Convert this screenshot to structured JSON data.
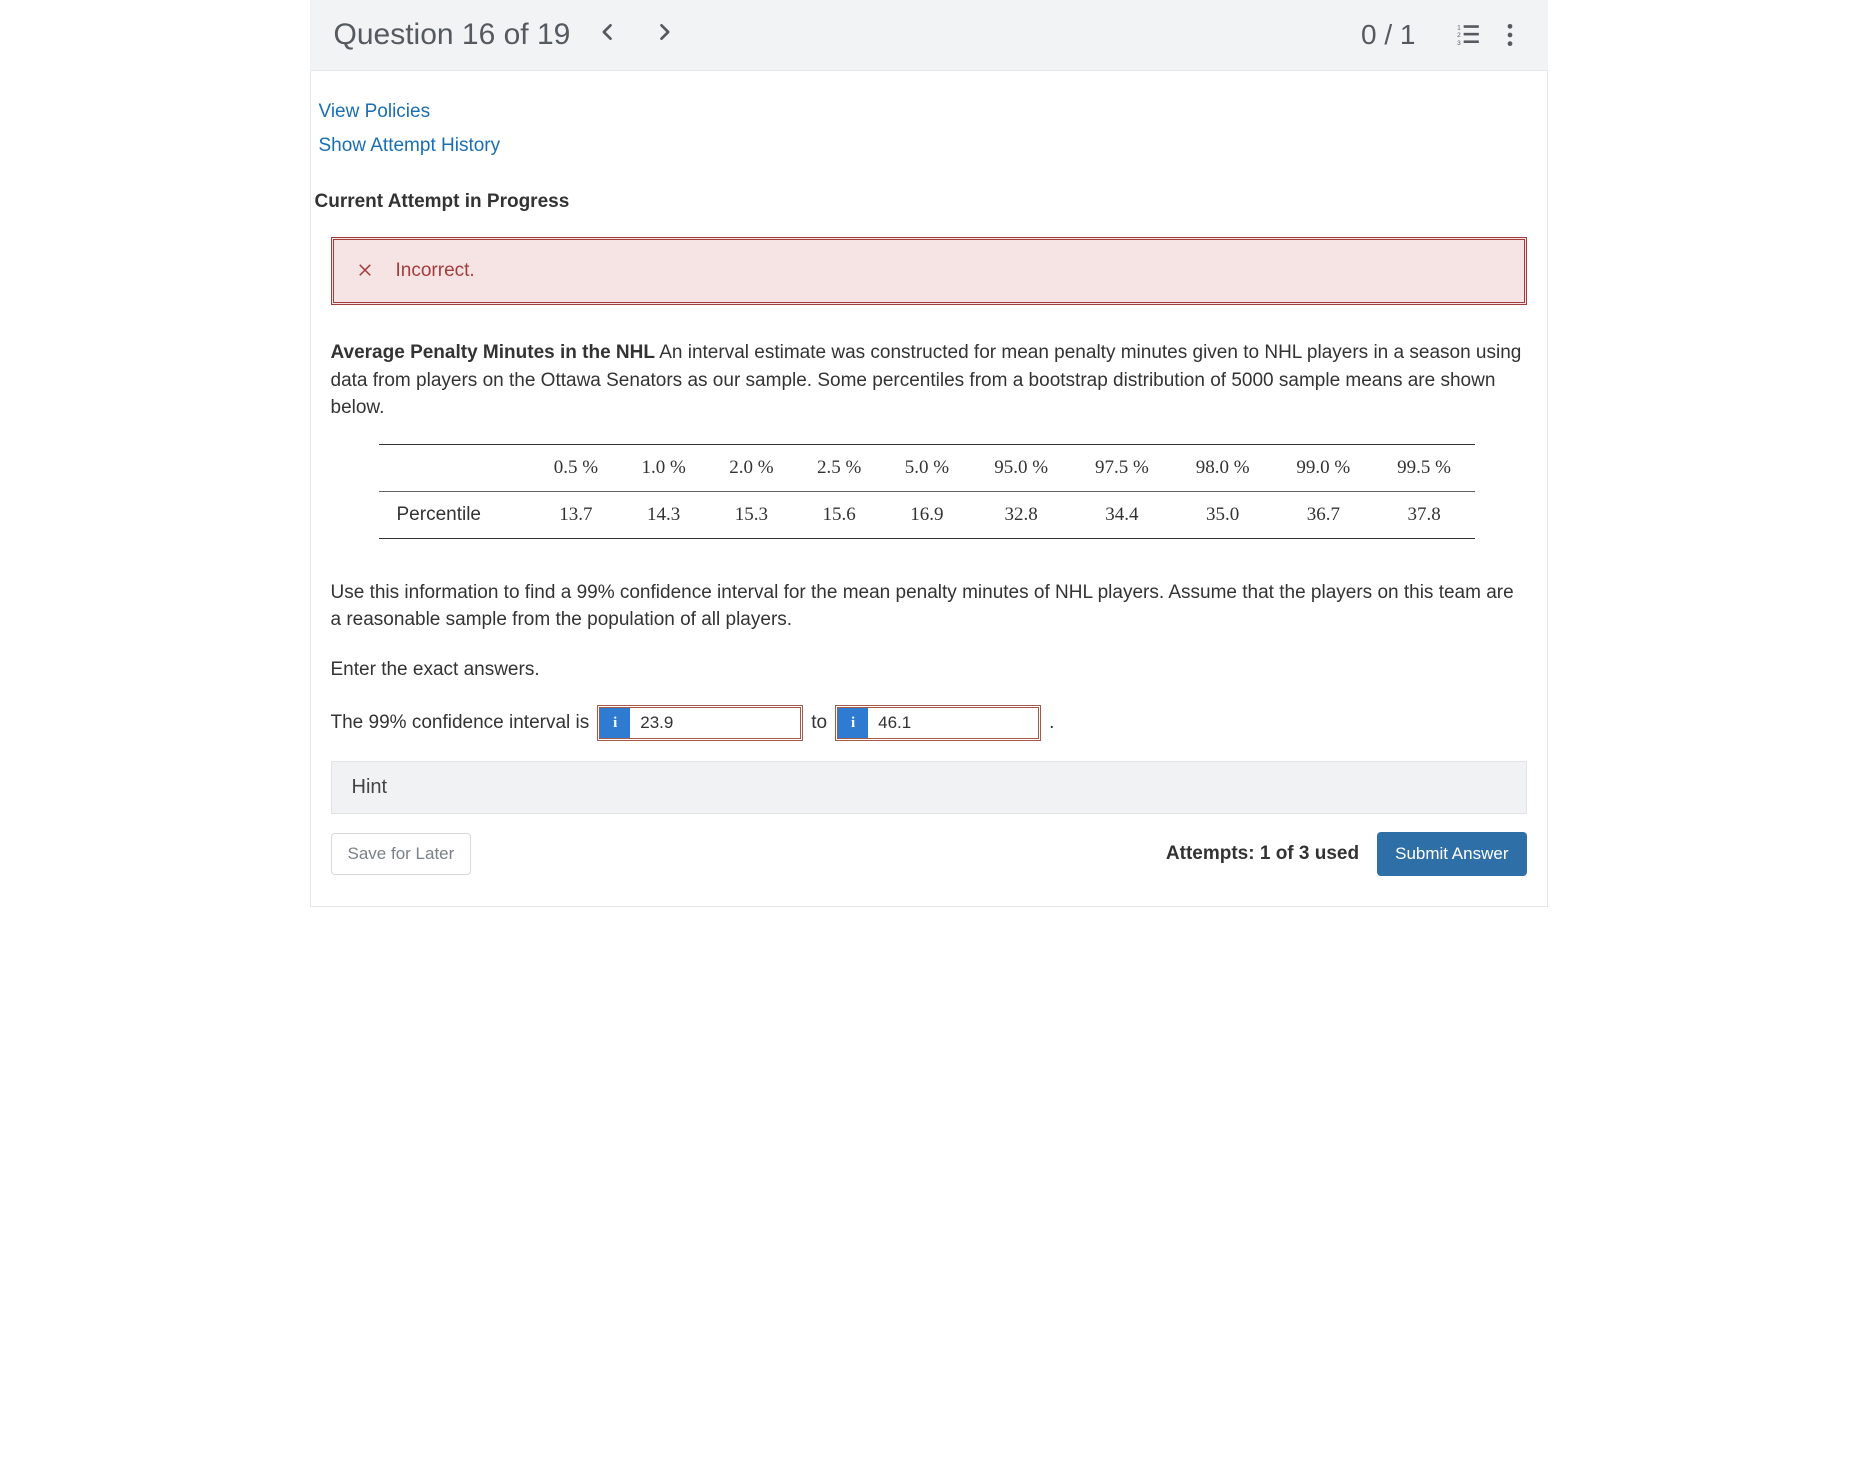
{
  "header": {
    "title": "Question 16 of 19",
    "score": "0 / 1"
  },
  "links": {
    "policies": "View Policies",
    "attempt_history": "Show Attempt History"
  },
  "section_title": "Current Attempt in Progress",
  "status": {
    "label": "Incorrect."
  },
  "question": {
    "heading": "Average Penalty Minutes in the NHL",
    "body_after_heading": " An interval estimate was constructed for mean penalty minutes given to NHL players in a season using data from players on the Ottawa Senators as our sample. Some percentiles from a bootstrap distribution of 5000 sample means are shown below.",
    "table": {
      "row_label": "Percentile",
      "headers": [
        "0.5 %",
        "1.0 %",
        "2.0 %",
        "2.5 %",
        "5.0 %",
        "95.0 %",
        "97.5 %",
        "98.0 %",
        "99.0 %",
        "99.5 %"
      ],
      "values": [
        "13.7",
        "14.3",
        "15.3",
        "15.6",
        "16.9",
        "32.8",
        "34.4",
        "35.0",
        "36.7",
        "37.8"
      ]
    },
    "paragraph2": "Use this information to find a 99% confidence interval for the mean penalty minutes of NHL players. Assume that the players on this team are a reasonable sample from the population of all players.",
    "paragraph3": "Enter the exact answers.",
    "answer_prefix": "The 99% confidence interval is",
    "answer_to": "to",
    "answer_period": ".",
    "input1_value": "23.9",
    "input2_value": "46.1",
    "info_glyph": "i"
  },
  "hint": {
    "label": "Hint"
  },
  "footer": {
    "save_label": "Save for Later",
    "attempts": "Attempts: 1 of 3 used",
    "submit_label": "Submit Answer"
  }
}
